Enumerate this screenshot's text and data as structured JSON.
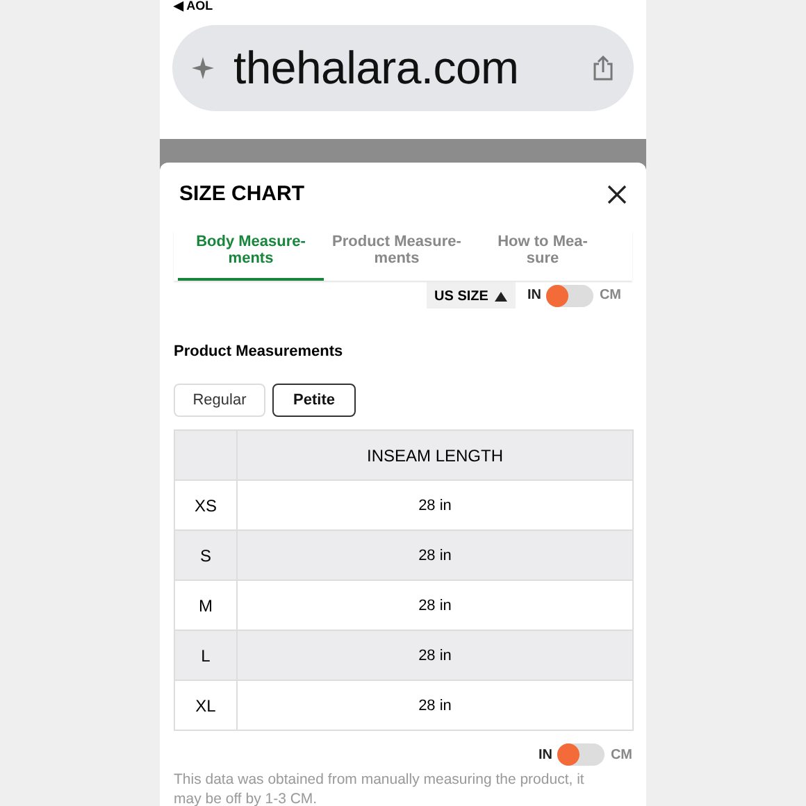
{
  "status_bar": {
    "back_label": "◀ AOL"
  },
  "address_bar": {
    "url": "thehalara.com"
  },
  "size_chart": {
    "title": "SIZE CHART",
    "tabs": [
      {
        "label": "Body Measure-\nments",
        "selected": true
      },
      {
        "label": "Product Measure-\nments",
        "selected": false
      },
      {
        "label": "How to Mea-\nsure",
        "selected": false
      }
    ],
    "size_system": "US SIZE",
    "unit_toggle_top": {
      "left": "IN",
      "right": "CM",
      "on": false
    },
    "section_title": "Product Measurements",
    "fits": [
      {
        "label": "Regular",
        "selected": false
      },
      {
        "label": "Petite",
        "selected": true
      }
    ],
    "table": {
      "columns": [
        "INSEAM LENGTH"
      ],
      "rows": [
        {
          "size": "XS",
          "value": "28 in"
        },
        {
          "size": "S",
          "value": "28 in"
        },
        {
          "size": "M",
          "value": "28 in"
        },
        {
          "size": "L",
          "value": "28 in"
        },
        {
          "size": "XL",
          "value": "28 in"
        }
      ]
    },
    "unit_toggle_bottom": {
      "left": "IN",
      "right": "CM",
      "on": false
    },
    "note": "This data was obtained from manually measuring the product, it may be off by 1-3 CM."
  }
}
